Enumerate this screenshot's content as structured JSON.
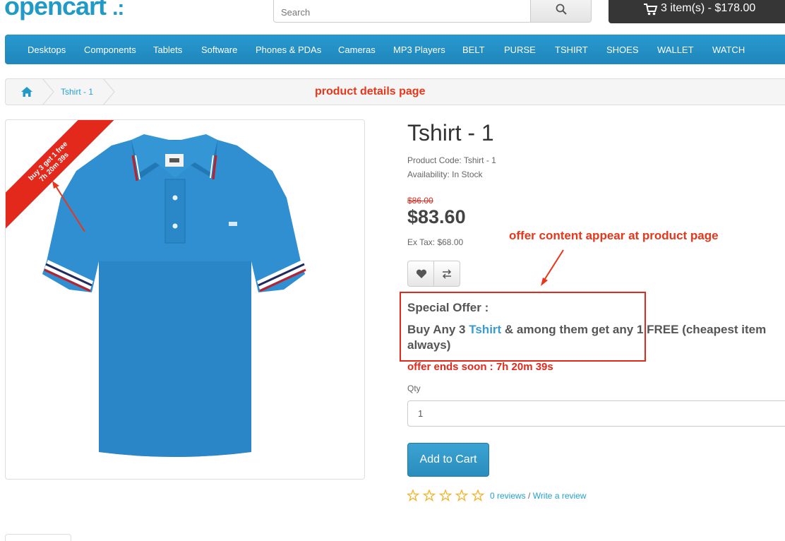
{
  "header": {
    "logo_text": "opencart",
    "logo_tail": ".:",
    "search_placeholder": "Search",
    "cart_label": "3 item(s) - $178.00"
  },
  "menu": {
    "items": [
      "Desktops",
      "Components",
      "Tablets",
      "Software",
      "Phones & PDAs",
      "Cameras",
      "MP3 Players",
      "BELT",
      "PURSE",
      "TSHIRT",
      "SHOES",
      "WALLET",
      "WATCH"
    ]
  },
  "breadcrumb": {
    "current": "Tshirt - 1"
  },
  "annotations": {
    "page_title": "product details page",
    "offer_note": "offer content appear at product page"
  },
  "image_badge": {
    "line1": "buy 3 get 1 free",
    "line2": "7h 20m 39s"
  },
  "product": {
    "title": "Tshirt - 1",
    "code_line": "Product Code: Tshirt - 1",
    "availability_line": "Availability: In Stock",
    "old_price": "$86.00",
    "price": "$83.60",
    "ex_tax": "Ex Tax: $68.00"
  },
  "offer": {
    "heading": "Special Offer :",
    "text_before": "Buy Any 3 ",
    "category_link": "Tshirt",
    "text_after": " & among them get any 1 FREE (cheapest item",
    "text_line2": "always)",
    "ends": "offer ends soon : 7h 20m 39s"
  },
  "purchase": {
    "qty_label": "Qty",
    "qty_value": "1",
    "add_to_cart": "Add to Cart"
  },
  "reviews": {
    "rating": 0,
    "max_rating": 5,
    "count_text": "0 reviews",
    "separator": " / ",
    "write_text": "Write a review"
  },
  "colors": {
    "brand_blue": "#229ac8",
    "alert_red": "#e2291c",
    "shirt_blue": "#2f8fd0"
  }
}
